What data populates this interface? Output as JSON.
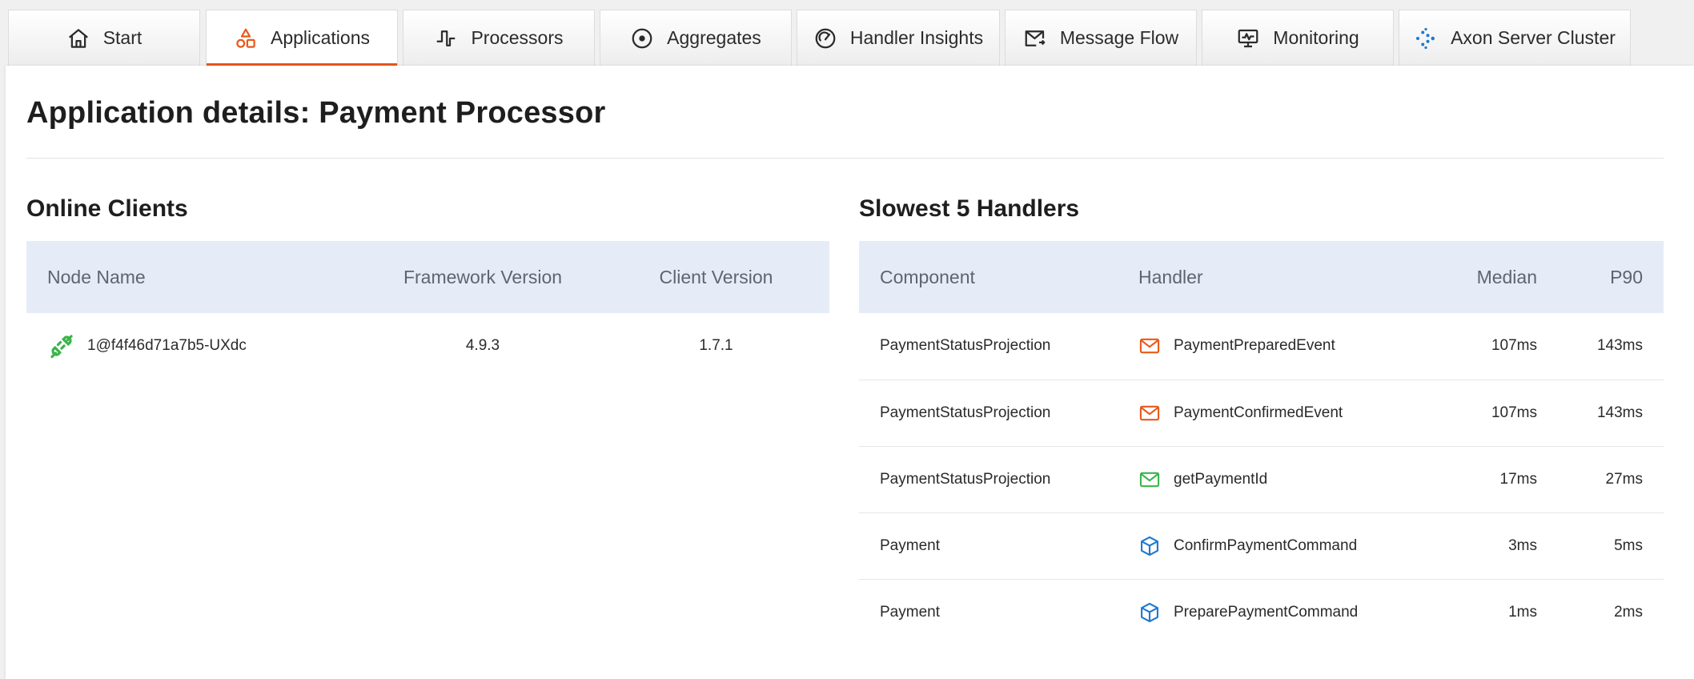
{
  "tabs": [
    {
      "label": "Start",
      "icon": "home-icon",
      "active": false
    },
    {
      "label": "Applications",
      "icon": "shapes-icon",
      "active": true
    },
    {
      "label": "Processors",
      "icon": "pulse-icon",
      "active": false
    },
    {
      "label": "Aggregates",
      "icon": "target-icon",
      "active": false
    },
    {
      "label": "Handler Insights",
      "icon": "gauge-icon",
      "active": false
    },
    {
      "label": "Message Flow",
      "icon": "mail-flow-icon",
      "active": false
    },
    {
      "label": "Monitoring",
      "icon": "monitor-icon",
      "active": false
    },
    {
      "label": "Axon Server Cluster",
      "icon": "axon-cluster-icon",
      "active": false
    }
  ],
  "colors": {
    "accent": "#e8591a",
    "table_header": "#e6ecf7",
    "connected_green": "#3cb44b",
    "event_orange": "#e8591a",
    "query_green": "#3cb44b",
    "command_blue": "#1f78d1"
  },
  "page": {
    "title": "Application details: Payment Processor"
  },
  "online_clients": {
    "title": "Online Clients",
    "columns": [
      "Node Name",
      "Framework Version",
      "Client Version"
    ],
    "rows": [
      {
        "node_name": "1@f4f46d71a7b5-UXdc",
        "framework_version": "4.9.3",
        "client_version": "1.7.1",
        "icon": "connected-plug-icon"
      }
    ]
  },
  "slowest_handlers": {
    "title": "Slowest 5 Handlers",
    "columns": [
      "Component",
      "Handler",
      "Median",
      "P90"
    ],
    "rows": [
      {
        "component": "PaymentStatusProjection",
        "handler": "PaymentPreparedEvent",
        "type": "event",
        "icon": "envelope-icon",
        "median": "107ms",
        "p90": "143ms"
      },
      {
        "component": "PaymentStatusProjection",
        "handler": "PaymentConfirmedEvent",
        "type": "event",
        "icon": "envelope-icon",
        "median": "107ms",
        "p90": "143ms"
      },
      {
        "component": "PaymentStatusProjection",
        "handler": "getPaymentId",
        "type": "query",
        "icon": "envelope-icon",
        "median": "17ms",
        "p90": "27ms"
      },
      {
        "component": "Payment",
        "handler": "ConfirmPaymentCommand",
        "type": "command",
        "icon": "cube-icon",
        "median": "3ms",
        "p90": "5ms"
      },
      {
        "component": "Payment",
        "handler": "PreparePaymentCommand",
        "type": "command",
        "icon": "cube-icon",
        "median": "1ms",
        "p90": "2ms"
      }
    ]
  }
}
